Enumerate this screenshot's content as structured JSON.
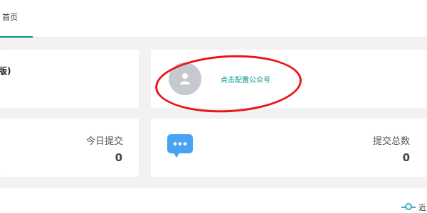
{
  "tabs": [
    {
      "label": "首页",
      "active": true
    }
  ],
  "cards": {
    "account": {
      "title_fragment": "版)"
    },
    "wechat": {
      "config_link": "点击配置公众号"
    },
    "today": {
      "label": "今日提交",
      "value": "0"
    },
    "total": {
      "label": "提交总数",
      "value": "0"
    }
  },
  "chart": {
    "legend_fragment": "近"
  },
  "colors": {
    "accent": "#009688",
    "highlight": "#e8161a",
    "chat_icon": "#4aa3f0",
    "legend_line": "#3fa9c9"
  },
  "icons": {
    "avatar": "user-avatar-icon",
    "chat": "chat-bubble-icon"
  }
}
